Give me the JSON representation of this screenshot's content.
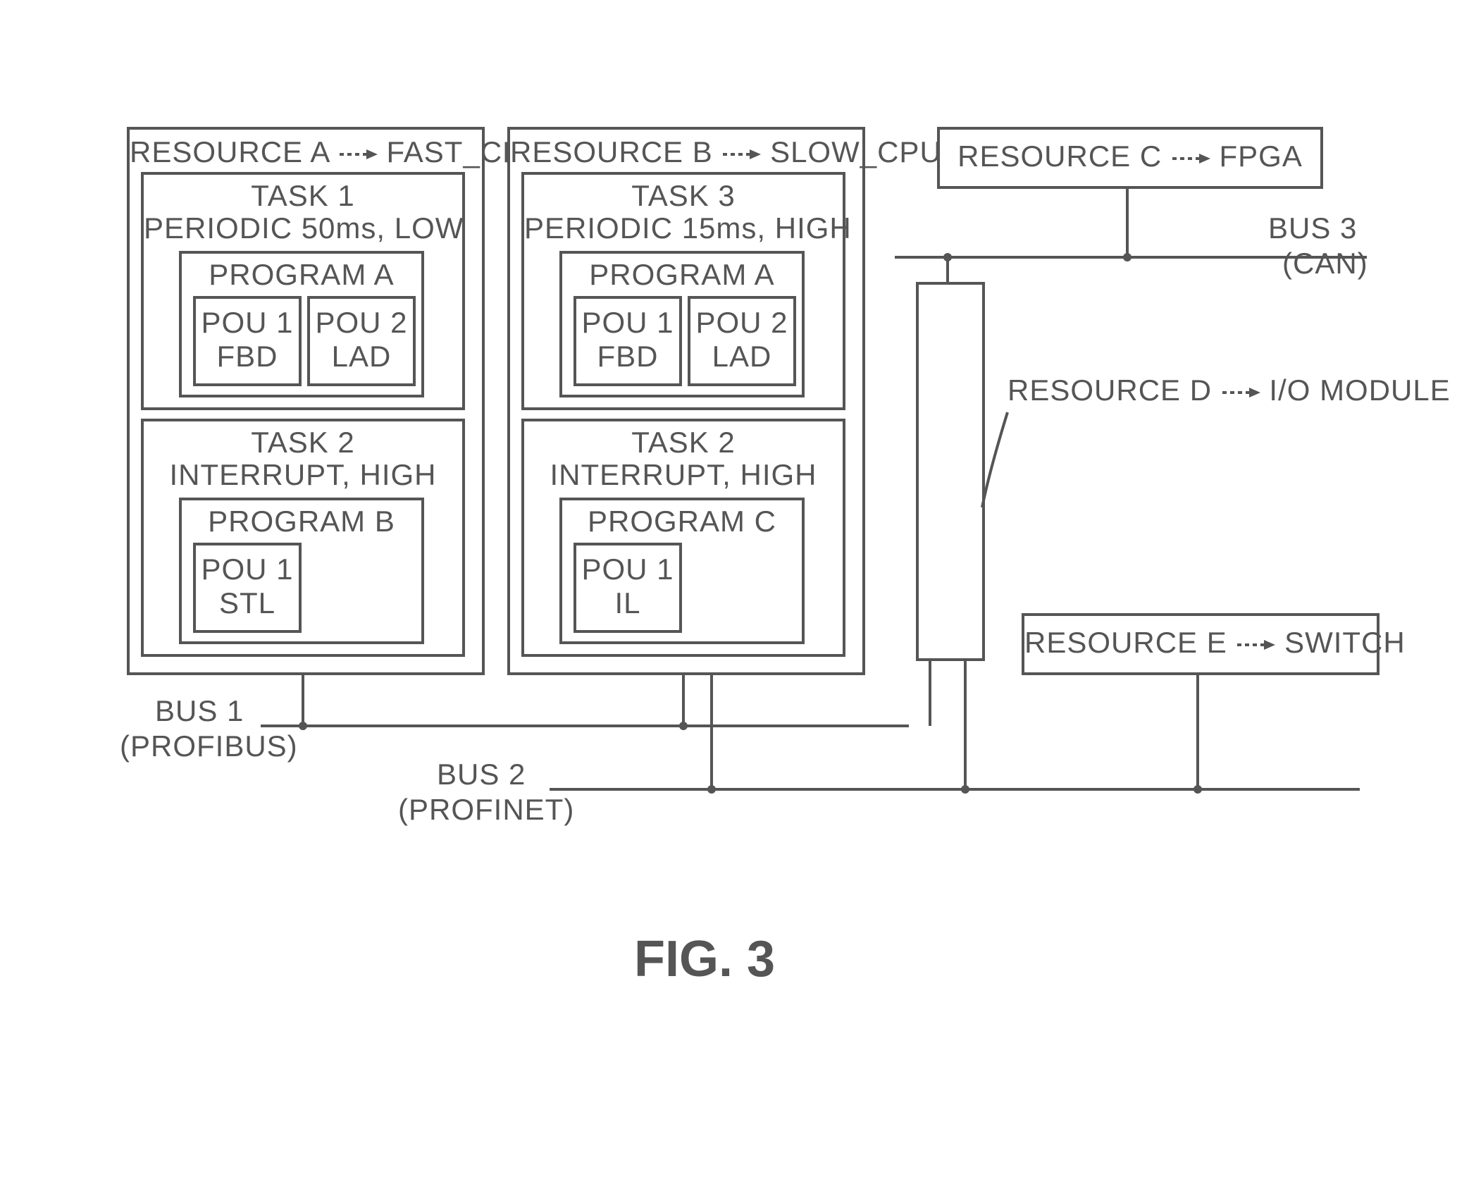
{
  "figure": "FIG. 3",
  "resourceA": {
    "name": "RESOURCE A",
    "target": "FAST_CPU"
  },
  "resourceB": {
    "name": "RESOURCE B",
    "target": "SLOW_CPU"
  },
  "resourceC": {
    "name": "RESOURCE C",
    "target": "FPGA"
  },
  "resourceD": {
    "name": "RESOURCE D",
    "target": "I/O MODULE"
  },
  "resourceE": {
    "name": "RESOURCE E",
    "target": "SWITCH"
  },
  "taskA1": {
    "title": "TASK 1",
    "desc": "PERIODIC 50ms, LOW"
  },
  "taskA2": {
    "title": "TASK 2",
    "desc": "INTERRUPT, HIGH"
  },
  "taskB3": {
    "title": "TASK 3",
    "desc": "PERIODIC 15ms, HIGH"
  },
  "taskB2": {
    "title": "TASK 2",
    "desc": "INTERRUPT, HIGH"
  },
  "progA": "PROGRAM A",
  "progB": "PROGRAM B",
  "progC": "PROGRAM  C",
  "pou1fbd": {
    "l1": "POU 1",
    "l2": "FBD"
  },
  "pou2lad": {
    "l1": "POU 2",
    "l2": "LAD"
  },
  "pou1stl": {
    "l1": "POU 1",
    "l2": "STL"
  },
  "pou1il": {
    "l1": "POU 1",
    "l2": "IL"
  },
  "bus1": {
    "name": "BUS 1",
    "proto": "(PROFIBUS)"
  },
  "bus2": {
    "name": "BUS 2",
    "proto": "(PROFINET)"
  },
  "bus3": {
    "name": "BUS 3",
    "proto": "(CAN)"
  }
}
